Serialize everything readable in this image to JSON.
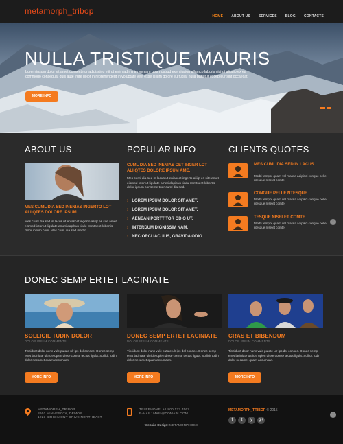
{
  "header": {
    "logo": "metamorph_tribop",
    "nav": [
      "HOME",
      "ABOUT US",
      "SERVICES",
      "BLOG",
      "CONTACTS"
    ]
  },
  "hero": {
    "title": "NULLA TRISTIQUE MAURIS",
    "text": "Lorem ipsum dolor sit amet consectetur adipiscing elit ut enim ad minim veniam quis nostrud exercitation ullamco laboris nisi ut aliquip ex ea commodo consequat duis aute irure dolor in reprehenderit in voluptate velit esse cillum dolore eu fugiat nulla pariatur excepteur sint occaecat.",
    "button": "MORE INFO"
  },
  "about": {
    "title": "ABOUT US",
    "subtitle": "MES CUML DIA SED INENIAS INGERTO LOT ALIIQTES DOLORE IPSUM.",
    "text": "Mes cuml dia sed in lacus ut eniascet ingerto aliiqt es site amet eismod ictor ut ligulate ameti dapibus ticdu nt mtsent lobortis dolor ipsum com. Mes cuml dia sed inertio."
  },
  "popular": {
    "title": "POPULAR INFO",
    "subtitle": "CUML DIA SED INENIAS CET INGER LOT ALIIQTES DOLORE IPSUM AME.",
    "text": "Mes cuml dia sed in lacus ut eniascet ingerto aliiqt es site amet eismod ictor ut ligulate ameti dapibus ticdu nt mtsent lobortis dolor ipsum consecte tuer cuml dia sed.",
    "items": [
      "LOREM IPSUM DOLOR SIT AMET.",
      "LOREM IPSUM DOLOR SIT AMET.",
      "AENEAN PORTTITOR ODIO UT.",
      "INTERDUM DIGNISSIM NAM.",
      "NEC ORCI IACULIS, GRAVIDA ODIO."
    ]
  },
  "clients": {
    "title": "CLIENTS QUOTES",
    "quotes": [
      {
        "title": "MES CUML DIA SED IN LACUS",
        "text": "Morbi tempor quam vel massa adipisci congue pelle ntesque niselet comte."
      },
      {
        "title": "CONGUE PELLE NTESQUE",
        "text": "Morbi tempor quam vel massa adipisci congue pelle ntesque niselet comte."
      },
      {
        "title": "TESQUE NISELET COMTE",
        "text": "Morbi tempor quam vel massa adipisci congue pelle ntesque niselet comte."
      }
    ]
  },
  "gallery": {
    "title": "DONEC SEMP ERTET LACINIATE",
    "cards": [
      {
        "title": "SOLLICIL TUDIN DOLOR",
        "subtitle": "DOLOR IPSUM COMMENTS",
        "text": "Tincidunt dolor nunc vule putate ulr ips dol consec. Donec semp ertet laciniate ultricie upien disse comse tectus ligula. Sollicit tudin dolor necamet quam accumsan.",
        "button": "MORE INFO"
      },
      {
        "title": "DONEC SEMP ERTET LACINIATE",
        "subtitle": "DOLOR IPSUM COMMENTS",
        "text": "Tincidunt dolor nunc vule putate ulr ips dol consec. Donec semp ertet laciniate ultricie upien disse comse tectus ligula. Sollicit tudin dolor necamet quam accumsan.",
        "button": "MORE INFO"
      },
      {
        "title": "CRAS ET BIBENDUM",
        "subtitle": "DOLOR IPSUM COMMENTS",
        "text": "Tincidunt dolor nunc vule putate ulr ips dol consec. Donec semp ertet laciniate ultricie upien disse comse tectus ligula. Sollicit tudin dolor necamet quam accumsan.",
        "button": "MORE INFO"
      }
    ]
  },
  "footer": {
    "address": [
      "METAMORPH_TRIBOP",
      "8901 MINNESOTA, DEMOS",
      "1223 BIRCHMONT DRIVE NORTHEAST"
    ],
    "contact": [
      "TELEPHONE: +1 800 123 4567",
      "E-MAIL: MAIL@DOMAIN.COM"
    ],
    "copyright_brand": "METAMORPH_TRIBOP",
    "copyright_year": "© 2015",
    "social": [
      "f",
      "t",
      "y",
      "g+"
    ],
    "design_label": "Website Design:",
    "design_by": "METAMORPHOSIS"
  },
  "colors": {
    "accent": "#f47b20",
    "logo": "#e64a19",
    "dark": "#2b2b2b"
  }
}
